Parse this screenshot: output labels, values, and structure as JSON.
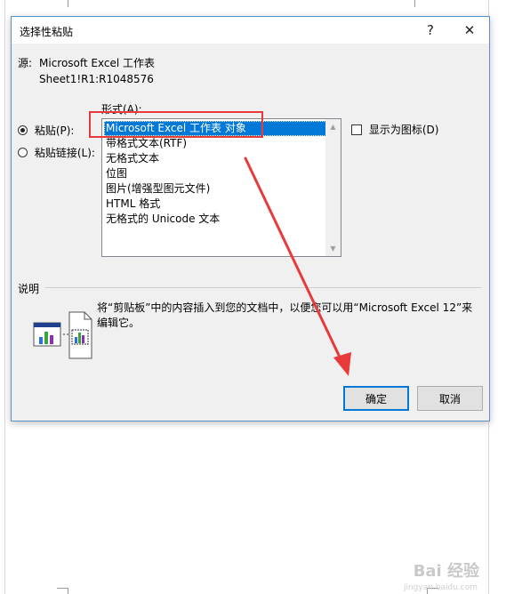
{
  "dialog": {
    "title": "选择性粘贴",
    "help_label": "?",
    "close_label": "✕",
    "source_label": "源:",
    "source_value": "Microsoft Excel 工作表",
    "source_range": "Sheet1!R1:R1048576",
    "format_label": "形式(A):",
    "paste_label": "粘贴(P):",
    "paste_link_label": "粘贴链接(L):",
    "formats": [
      "Microsoft Excel 工作表 对象",
      "带格式文本(RTF)",
      "无格式文本",
      "位图",
      "图片(增强型图元文件)",
      "HTML 格式",
      "无格式的 Unicode 文本"
    ],
    "selected_format_index": 0,
    "display_as_icon_label": "显示为图标(D)",
    "result_heading": "说明",
    "result_text": "将“剪贴板”中的内容插入到您的文档中，以便您可以用“Microsoft Excel 12”来编辑它。",
    "ok_label": "确定",
    "cancel_label": "取消"
  },
  "watermark": {
    "text": "Bai 经验",
    "subtext": "jingyan.baidu.com"
  },
  "colors": {
    "selection": "#0078d7",
    "annotation": "#e83a3a",
    "dialog_bg": "#f0f0f0"
  }
}
